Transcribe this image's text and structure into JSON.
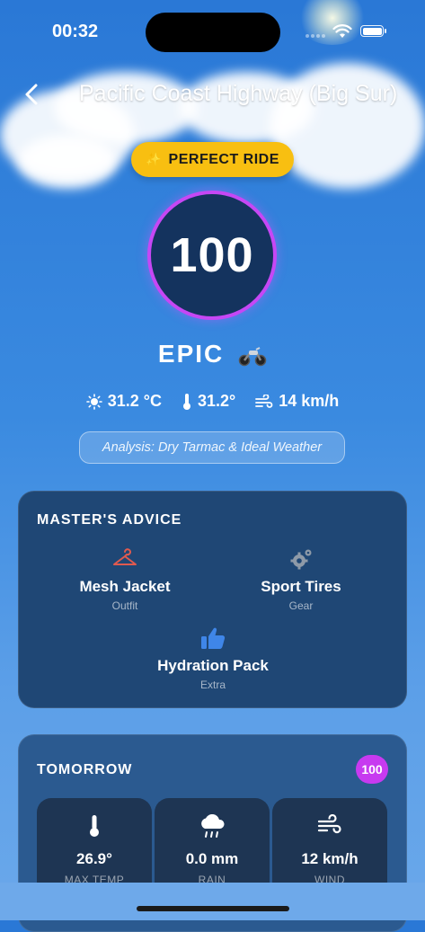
{
  "status": {
    "time": "00:32"
  },
  "nav": {
    "title": "Pacific Coast Highway (Big Sur)"
  },
  "badge": {
    "label": "PERFECT RIDE"
  },
  "score": {
    "value": "100",
    "rating": "EPIC"
  },
  "weather": {
    "temp": "31.2 °C",
    "feels": "31.2°",
    "wind": "14 km/h"
  },
  "analysis": "Analysis: Dry Tarmac & Ideal Weather",
  "advice": {
    "title": "MASTER'S ADVICE",
    "items": [
      {
        "name": "Mesh Jacket",
        "category": "Outfit",
        "icon": "hanger-icon"
      },
      {
        "name": "Sport Tires",
        "category": "Gear",
        "icon": "gears-icon"
      },
      {
        "name": "Hydration Pack",
        "category": "Extra",
        "icon": "thumbs-up-icon"
      }
    ]
  },
  "tomorrow": {
    "title": "TOMORROW",
    "score": "100",
    "tiles": [
      {
        "value": "26.9°",
        "label": "MAX TEMP",
        "icon": "thermometer-icon"
      },
      {
        "value": "0.0 mm",
        "label": "RAIN",
        "icon": "rain-cloud-icon"
      },
      {
        "value": "12 km/h",
        "label": "WIND",
        "icon": "wind-icon"
      }
    ]
  },
  "colors": {
    "badge": "#f8bf11",
    "ring": "#c647f5",
    "card": "#1f4775",
    "jacket_icon": "#e05a4f",
    "thumb_icon": "#3f86e8"
  }
}
